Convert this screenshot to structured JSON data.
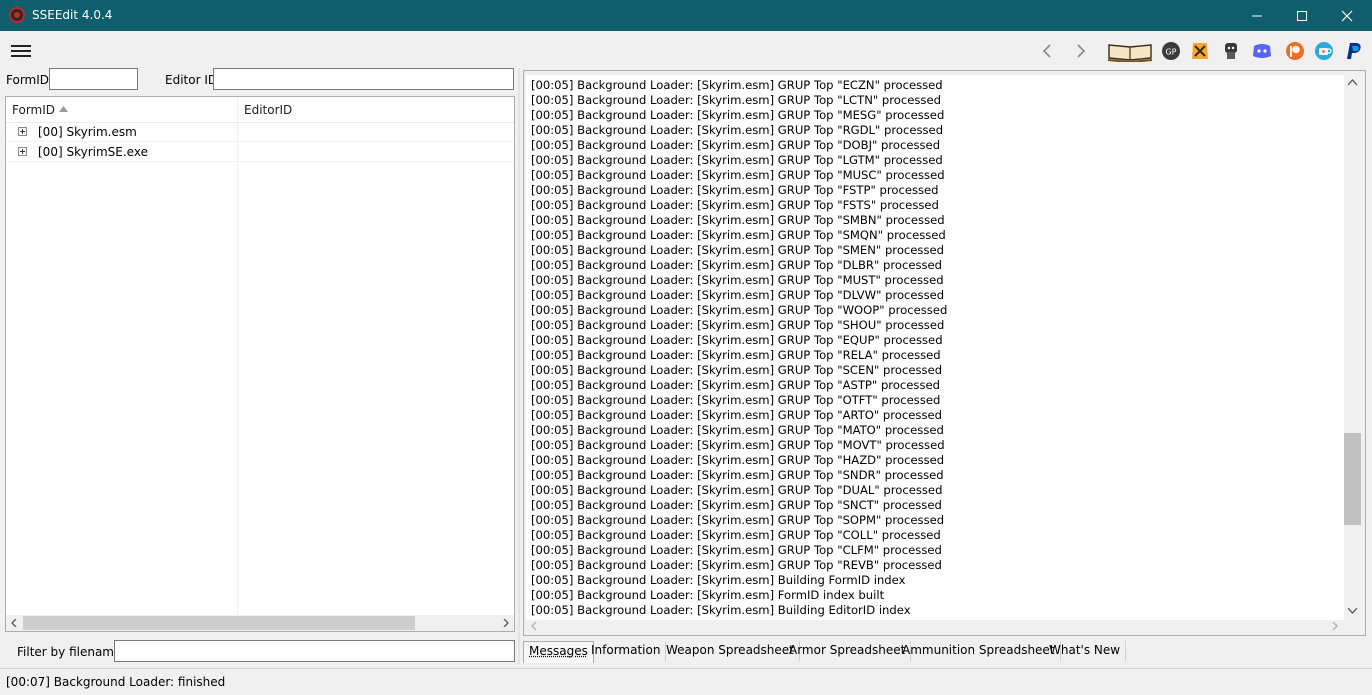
{
  "window": {
    "title": "SSEEdit 4.0.4"
  },
  "search": {
    "formid_label": "FormID",
    "formid_value": "",
    "editorid_label": "Editor ID",
    "editorid_value": ""
  },
  "tree": {
    "columns": [
      "FormID",
      "EditorID"
    ],
    "rows": [
      "[00] Skyrim.esm",
      "[00] SkyrimSE.exe"
    ]
  },
  "filter": {
    "label": "Filter by filename:",
    "value": ""
  },
  "messages": [
    "[00:05] Background Loader: [Skyrim.esm] GRUP Top \"ECZN\" processed",
    "[00:05] Background Loader: [Skyrim.esm] GRUP Top \"LCTN\" processed",
    "[00:05] Background Loader: [Skyrim.esm] GRUP Top \"MESG\" processed",
    "[00:05] Background Loader: [Skyrim.esm] GRUP Top \"RGDL\" processed",
    "[00:05] Background Loader: [Skyrim.esm] GRUP Top \"DOBJ\" processed",
    "[00:05] Background Loader: [Skyrim.esm] GRUP Top \"LGTM\" processed",
    "[00:05] Background Loader: [Skyrim.esm] GRUP Top \"MUSC\" processed",
    "[00:05] Background Loader: [Skyrim.esm] GRUP Top \"FSTP\" processed",
    "[00:05] Background Loader: [Skyrim.esm] GRUP Top \"FSTS\" processed",
    "[00:05] Background Loader: [Skyrim.esm] GRUP Top \"SMBN\" processed",
    "[00:05] Background Loader: [Skyrim.esm] GRUP Top \"SMQN\" processed",
    "[00:05] Background Loader: [Skyrim.esm] GRUP Top \"SMEN\" processed",
    "[00:05] Background Loader: [Skyrim.esm] GRUP Top \"DLBR\" processed",
    "[00:05] Background Loader: [Skyrim.esm] GRUP Top \"MUST\" processed",
    "[00:05] Background Loader: [Skyrim.esm] GRUP Top \"DLVW\" processed",
    "[00:05] Background Loader: [Skyrim.esm] GRUP Top \"WOOP\" processed",
    "[00:05] Background Loader: [Skyrim.esm] GRUP Top \"SHOU\" processed",
    "[00:05] Background Loader: [Skyrim.esm] GRUP Top \"EQUP\" processed",
    "[00:05] Background Loader: [Skyrim.esm] GRUP Top \"RELA\" processed",
    "[00:05] Background Loader: [Skyrim.esm] GRUP Top \"SCEN\" processed",
    "[00:05] Background Loader: [Skyrim.esm] GRUP Top \"ASTP\" processed",
    "[00:05] Background Loader: [Skyrim.esm] GRUP Top \"OTFT\" processed",
    "[00:05] Background Loader: [Skyrim.esm] GRUP Top \"ARTO\" processed",
    "[00:05] Background Loader: [Skyrim.esm] GRUP Top \"MATO\" processed",
    "[00:05] Background Loader: [Skyrim.esm] GRUP Top \"MOVT\" processed",
    "[00:05] Background Loader: [Skyrim.esm] GRUP Top \"HAZD\" processed",
    "[00:05] Background Loader: [Skyrim.esm] GRUP Top \"SNDR\" processed",
    "[00:05] Background Loader: [Skyrim.esm] GRUP Top \"DUAL\" processed",
    "[00:05] Background Loader: [Skyrim.esm] GRUP Top \"SNCT\" processed",
    "[00:05] Background Loader: [Skyrim.esm] GRUP Top \"SOPM\" processed",
    "[00:05] Background Loader: [Skyrim.esm] GRUP Top \"COLL\" processed",
    "[00:05] Background Loader: [Skyrim.esm] GRUP Top \"CLFM\" processed",
    "[00:05] Background Loader: [Skyrim.esm] GRUP Top \"REVB\" processed",
    "[00:05] Background Loader: [Skyrim.esm] Building FormID index",
    "[00:05] Background Loader: [Skyrim.esm] FormID index built",
    "[00:05] Background Loader: [Skyrim.esm] Building EditorID index"
  ],
  "tabs": [
    "Messages",
    "Information",
    "Weapon Spreadsheet",
    "Armor Spreadsheet",
    "Ammunition Spreadsheet",
    "What's New"
  ],
  "status": {
    "text": "[00:07] Background Loader: finished"
  },
  "colors": {
    "titlebar": "#0f5e6e",
    "accent_orange": "#f26d21",
    "discord": "#5865f2",
    "paypal": "#003087"
  },
  "toolbar_icons": [
    "book-icon",
    "gp-icon",
    "nexus-icon",
    "github-icon",
    "discord-icon",
    "patreon-icon",
    "kofi-icon",
    "paypal-icon"
  ]
}
